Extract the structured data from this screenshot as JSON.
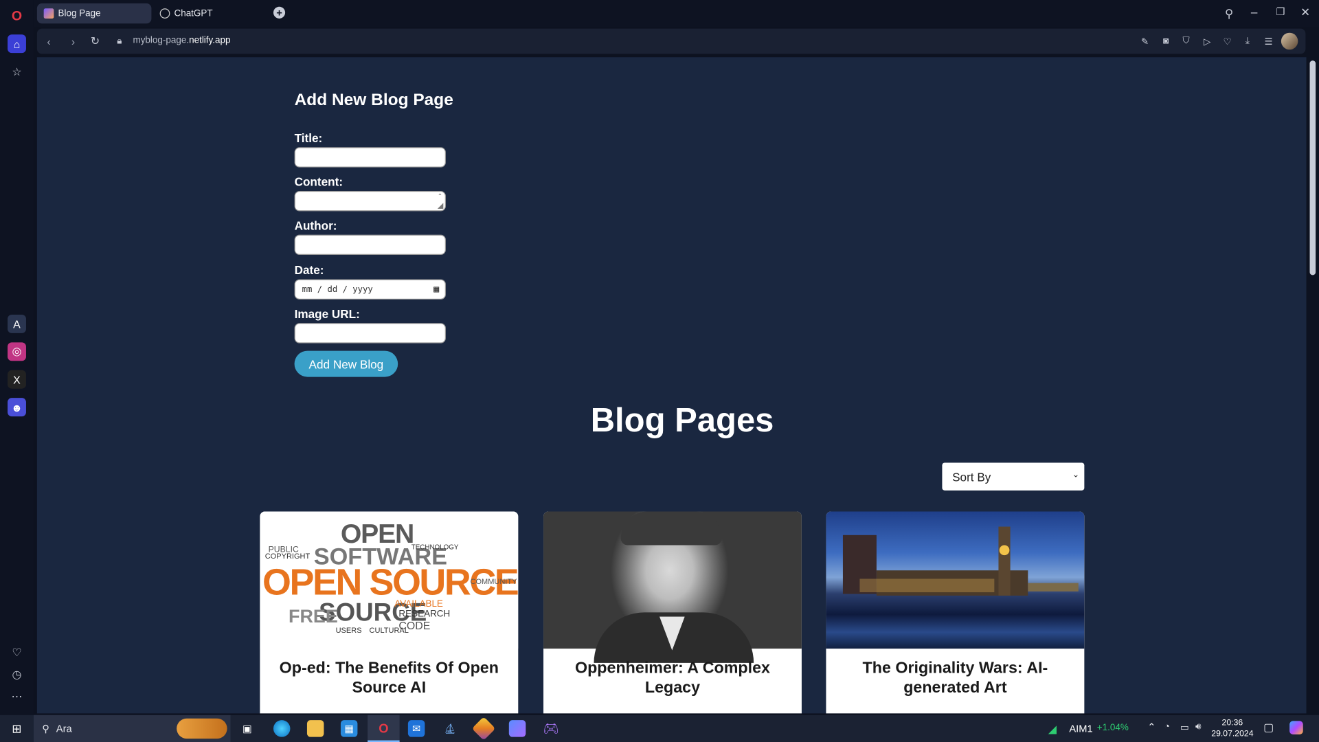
{
  "browser": {
    "tabs": [
      {
        "label": "Blog Page"
      },
      {
        "label": "ChatGPT"
      }
    ],
    "new_tab_glyph": "+",
    "url": {
      "host_prefix": "myblog-page.",
      "host_main": "netlify.app"
    }
  },
  "form": {
    "heading": "Add New Blog Page",
    "title_label": "Title:",
    "content_label": "Content:",
    "author_label": "Author:",
    "date_label": "Date:",
    "date_placeholder": "mm / dd / yyyy",
    "image_label": "Image URL:",
    "submit_label": "Add New Blog"
  },
  "listing": {
    "heading": "Blog Pages",
    "sort_label": "Sort By",
    "cards": [
      {
        "title": "Op-ed: The Benefits Of Open Source AI",
        "image": "open-source-word-cloud"
      },
      {
        "title": "Oppenheimer: A Complex Legacy",
        "image": "oppenheimer-portrait"
      },
      {
        "title": "The Originality Wars: AI-generated Art",
        "image": "westminster-painting"
      }
    ]
  },
  "taskbar": {
    "search_placeholder": "Ara",
    "stock_ticker": "AIM1",
    "stock_change": "+1.04%",
    "time": "20:36",
    "date": "29.07.2024"
  },
  "colors": {
    "accent": "#3aa0c8",
    "page_bg": "#1a2740",
    "stock_up": "#2ecc71"
  },
  "icons": [
    "opera-logo-icon",
    "home-icon",
    "star-icon",
    "aria-icon",
    "instagram-icon",
    "x-icon",
    "messenger-icon",
    "heart-icon",
    "history-icon",
    "more-icon",
    "search-icon",
    "minimize-icon",
    "restore-icon",
    "close-icon",
    "back-icon",
    "forward-icon",
    "reload-icon",
    "lock-icon",
    "snapshot-icon",
    "camera-icon",
    "shield-icon",
    "play-icon",
    "heart-outline-icon",
    "download-icon",
    "menu-icon",
    "avatar",
    "windows-icon",
    "taskbar-search-icon",
    "task-view-icon",
    "edge-icon",
    "explorer-icon",
    "store-icon",
    "opera-taskbar-icon",
    "mail-icon",
    "app-icon"
  ]
}
